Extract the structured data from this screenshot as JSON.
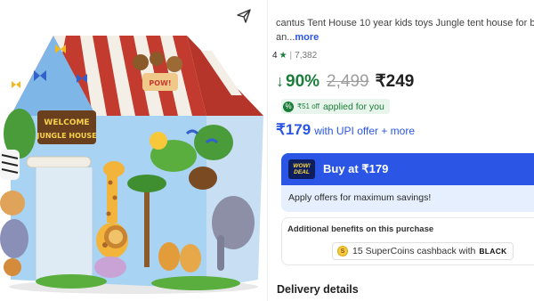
{
  "product": {
    "title_line1": "cantus Tent House 10 year kids toys Jungle tent house for b",
    "title_line2": "an...",
    "more_label": "more",
    "image_banner_line1": "WELCOME",
    "image_banner_line2": "JUNGLE HOUSE"
  },
  "rating": {
    "value": "4",
    "star": "★",
    "separator": "|",
    "count": "7,382"
  },
  "price": {
    "discount": "90%",
    "mrp": "2,499",
    "final": "₹249",
    "arrow": "↓"
  },
  "applied_offer": {
    "amount": "₹51 off",
    "text": "applied for you",
    "icon": "%"
  },
  "upi_offer": {
    "price": "₹179",
    "text": "with UPI offer + more"
  },
  "buy": {
    "badge_line1": "WOW!",
    "badge_line2": "DEAL",
    "label": "Buy at ₹179",
    "offers_text": "Apply offers for maximum savings!"
  },
  "benefits": {
    "title": "Additional benefits on this purchase",
    "coins_text": "15 SuperCoins cashback with",
    "black_label": "BLACK",
    "coin_symbol": "S"
  },
  "delivery": {
    "title": "Delivery details"
  },
  "icons": {
    "share": "share-icon"
  },
  "colors": {
    "accent_blue": "#2a55e5",
    "discount_green": "#1b7d3a",
    "buy_card_bg": "#e6effd"
  }
}
